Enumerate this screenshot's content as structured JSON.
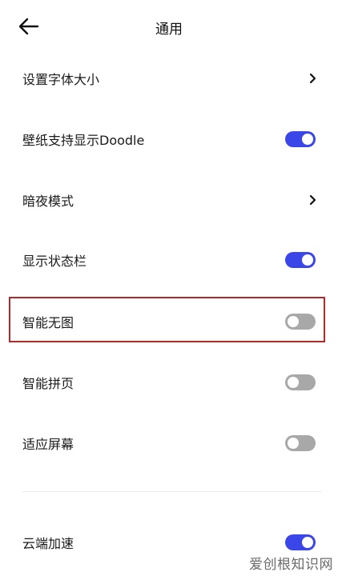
{
  "header": {
    "title": "通用",
    "back_icon": "arrow-left-icon"
  },
  "settings": [
    {
      "label": "设置字体大小",
      "control": "chevron"
    },
    {
      "label": "壁纸支持显示Doodle",
      "control": "toggle",
      "enabled": true
    },
    {
      "label": "暗夜模式",
      "control": "chevron"
    },
    {
      "label": "显示状态栏",
      "control": "toggle",
      "enabled": true
    },
    {
      "label": "智能无图",
      "control": "toggle",
      "enabled": false,
      "highlighted": true
    },
    {
      "label": "智能拼页",
      "control": "toggle",
      "enabled": false
    },
    {
      "label": "适应屏幕",
      "control": "toggle",
      "enabled": false
    },
    {
      "label": "云端加速",
      "control": "toggle",
      "enabled": true
    }
  ],
  "watermark": "爱创根知识网",
  "colors": {
    "toggle_on": "#3b46e8",
    "toggle_off": "#a8a8a8",
    "highlight_border": "#b02a2a"
  }
}
